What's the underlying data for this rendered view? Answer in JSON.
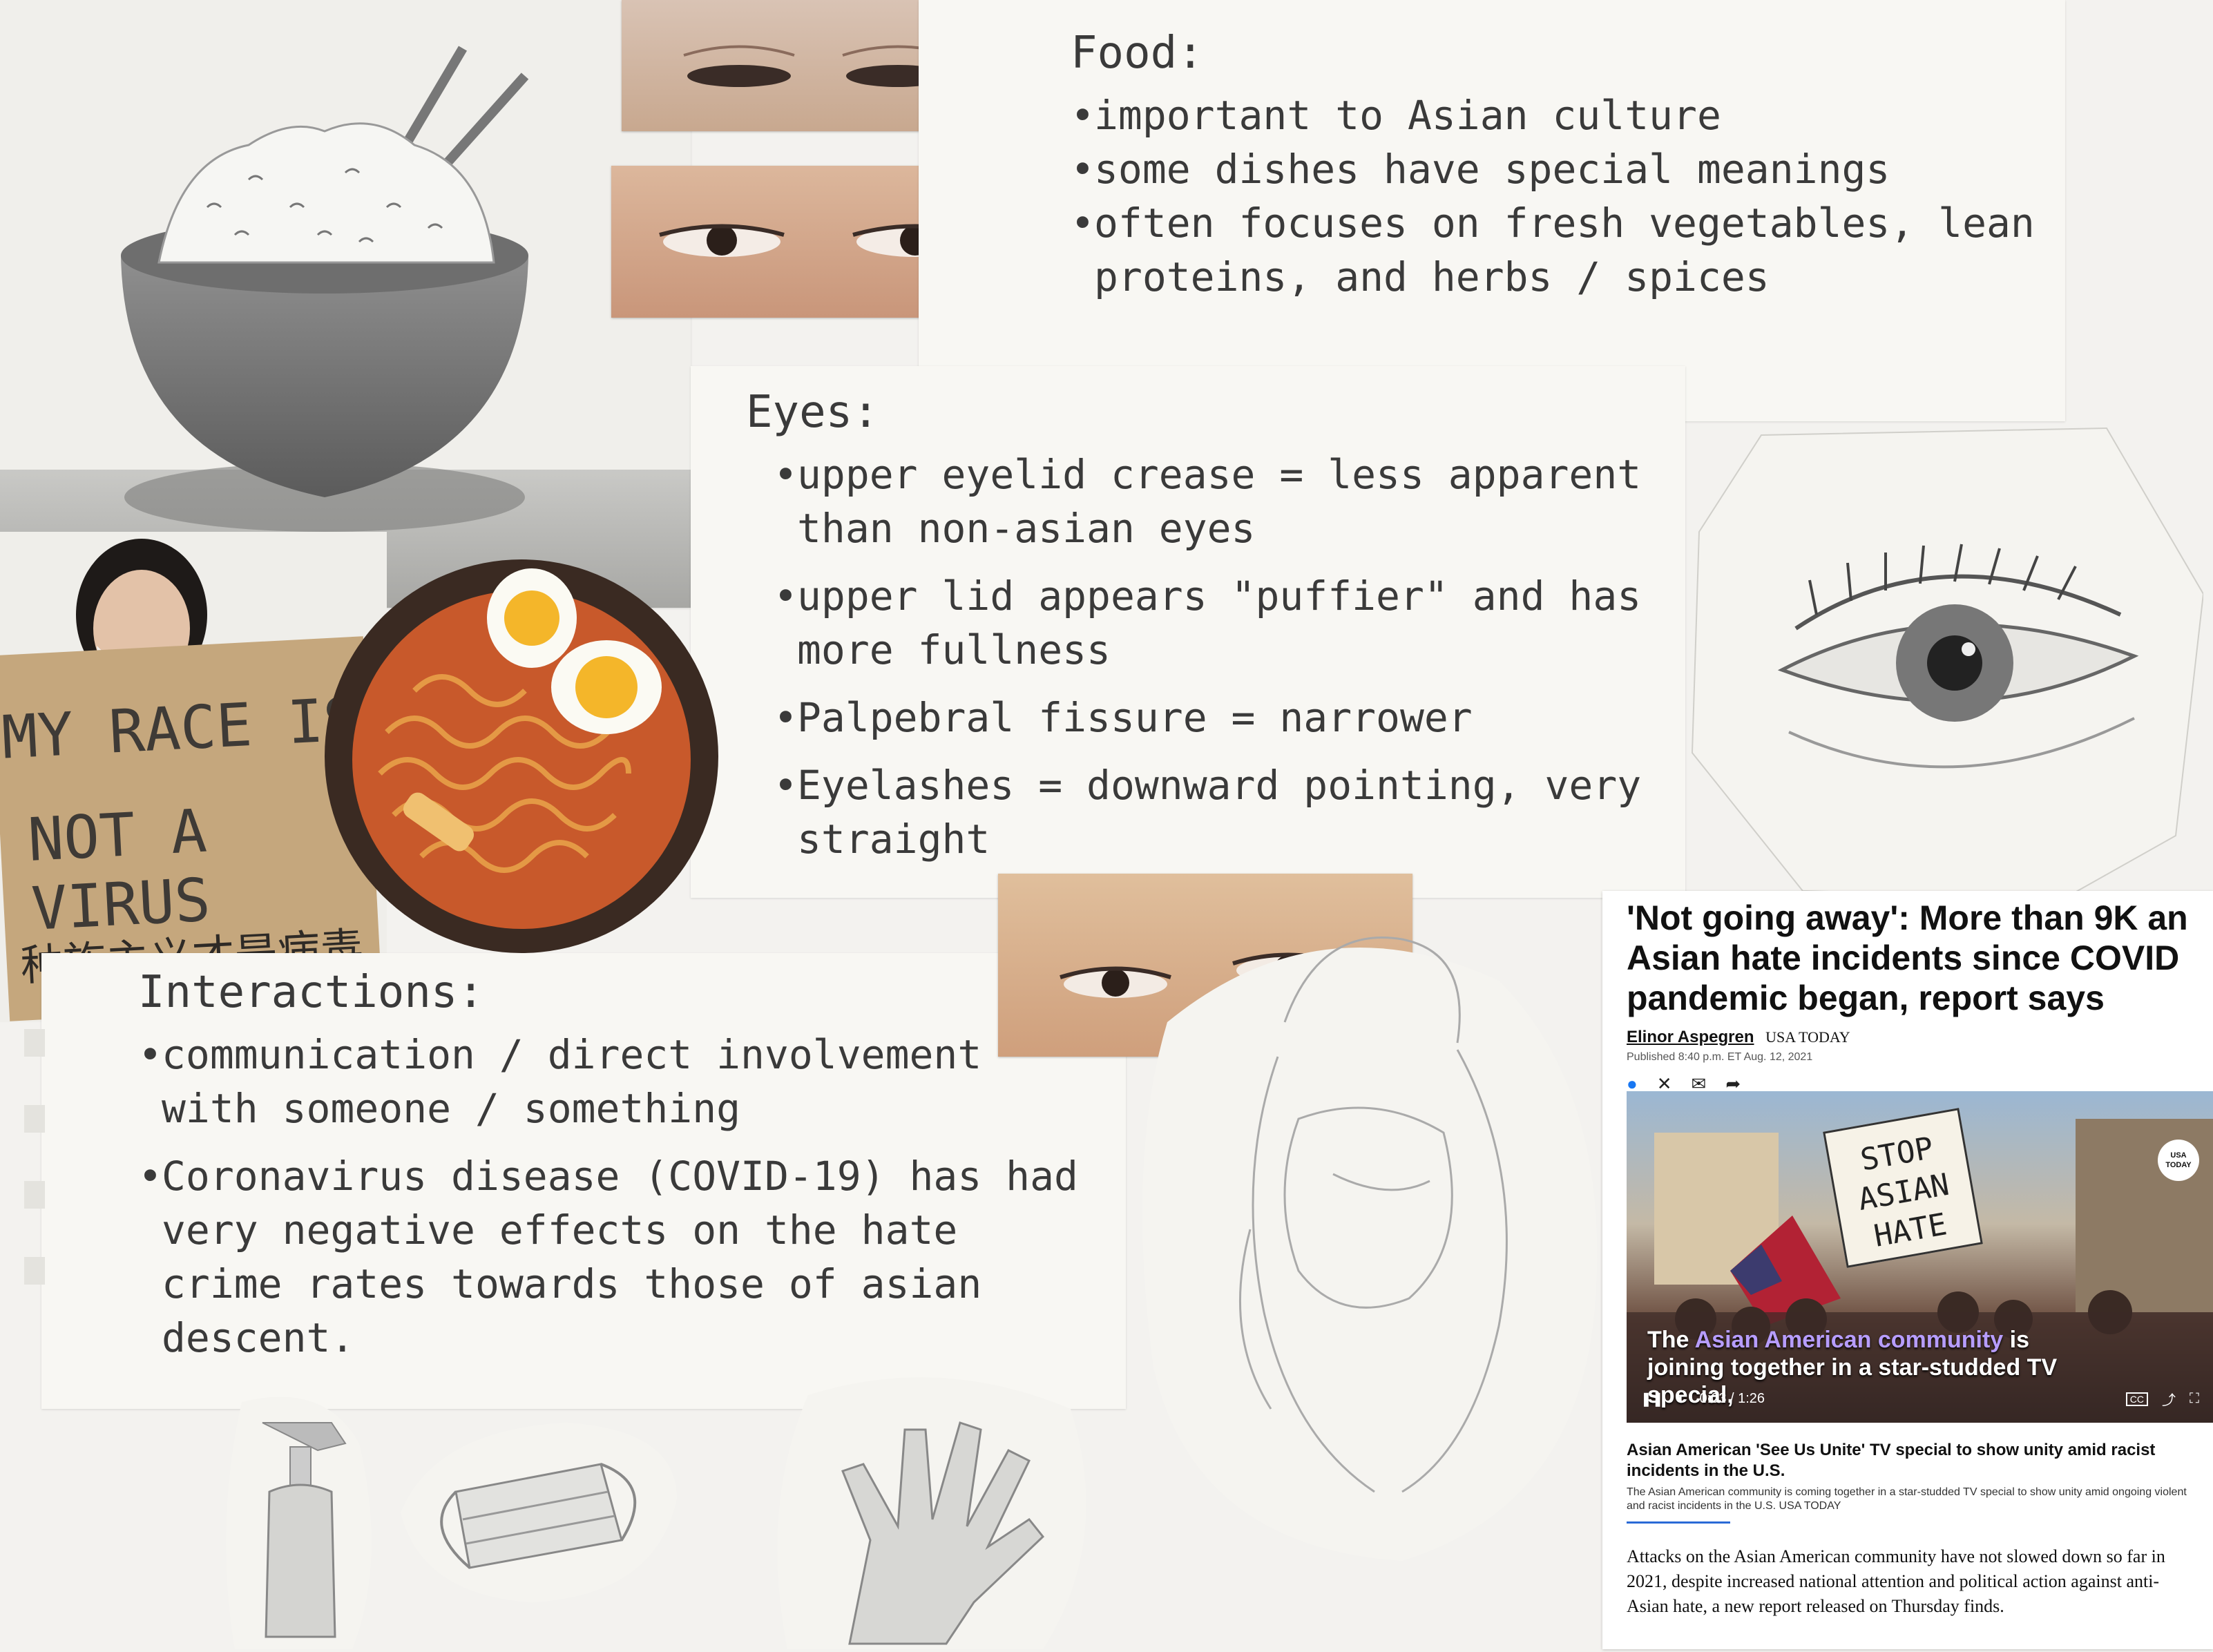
{
  "food_note": {
    "title": "Food:",
    "items": [
      "important to Asian culture",
      "some dishes have special meanings",
      "often focuses on fresh vegetables, lean proteins, and herbs / spices"
    ]
  },
  "eyes_note": {
    "title": "Eyes:",
    "items": [
      "upper eyelid crease = less apparent than non-asian eyes",
      "upper lid appears \"puffier\" and has more fullness",
      "Palpebral fissure = narrower",
      "Eyelashes = downward pointing, very straight"
    ]
  },
  "interactions_note": {
    "title": "Interactions:",
    "items": [
      "communication / direct involvement with someone / something",
      "Coronavirus disease (COVID-19) has had very negative effects on the hate crime rates towards those of asian descent."
    ]
  },
  "protest_sign": {
    "line1": "MY RACE IS",
    "line2": "NOT A VIRUS",
    "chinese": "种族主义才是病毒"
  },
  "news": {
    "headline": "'Not going away': More than 9K an Asian hate incidents since COVID pandemic began, report says",
    "author": "Elinor Aspegren",
    "outlet": "USA TODAY",
    "published": "Published 8:40 p.m. ET Aug. 12, 2021",
    "video_sign": "STOP ASIAN HATE",
    "badge": "USA TODAY",
    "caption_pre": "The ",
    "caption_highlight": "Asian American community",
    "caption_post": " is joining together in a star-studded TV special,",
    "time": "0:03 / 1:26",
    "video_title": "Asian American 'See Us Unite' TV special to show unity amid racist incidents in the U.S.",
    "video_desc": "The Asian American community is coming together in a star-studded TV special to show unity amid ongoing violent and racist incidents in the U.S. USA TODAY",
    "body": "Attacks on the Asian American community have not slowed down so far in 2021, despite increased national attention and political action against anti-Asian hate, a new report released on Thursday finds."
  }
}
